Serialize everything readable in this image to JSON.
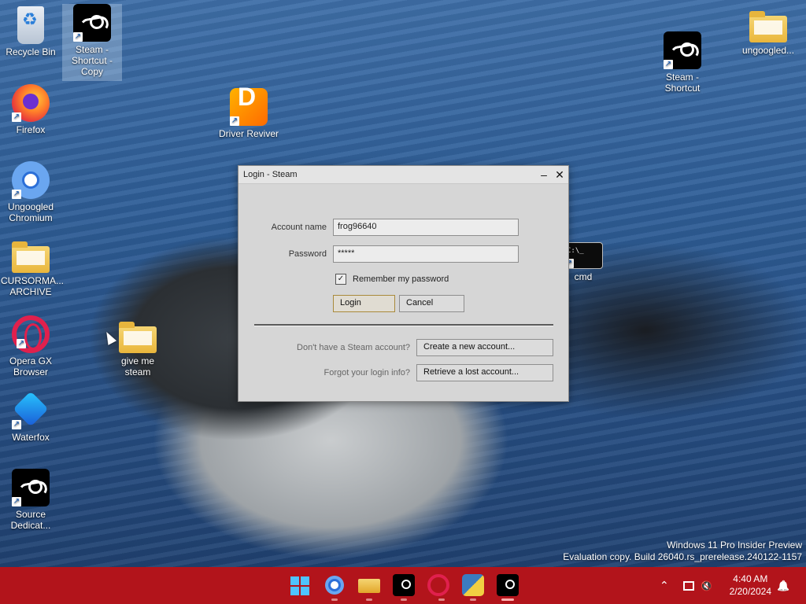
{
  "desktop_icons": {
    "recycle_bin": "Recycle Bin",
    "steam_copy": "Steam - Shortcut - Copy",
    "firefox": "Firefox",
    "driver_reviver": "Driver Reviver",
    "ungoogled_chromium": "Ungoogled Chromium",
    "cursorma": "CURSORMA... ARCHIVE",
    "opera_gx": "Opera GX Browser",
    "give_me_steam": "give me steam",
    "waterfox": "Waterfox",
    "source_dedicated": "Source Dedicat...",
    "steam_shortcut": "Steam - Shortcut",
    "ungoogled_folder": "ungoogled...",
    "cmd": "cmd"
  },
  "dialog": {
    "title": "Login - Steam",
    "minimize": "–",
    "close": "✕",
    "account_label": "Account name",
    "account_value": "frog96640",
    "password_label": "Password",
    "password_value": "*****",
    "remember_label": "Remember my password",
    "remember_checked": "✓",
    "login_button": "Login",
    "cancel_button": "Cancel",
    "no_account_hint": "Don't have a Steam account?",
    "create_button": "Create a new account...",
    "forgot_hint": "Forgot your login info?",
    "retrieve_button": "Retrieve a lost account..."
  },
  "watermark": {
    "line1": "Windows 11 Pro Insider Preview",
    "line2": "Evaluation copy. Build 26040.rs_prerelease.240122-1157"
  },
  "taskbar": {
    "clock_time": "4:40 AM",
    "clock_date": "2/20/2024",
    "chevron": "⌃",
    "notification_icon": "🔔"
  },
  "colors": {
    "taskbar": "#b2141b",
    "dialog_bg": "#d6d6d6"
  }
}
